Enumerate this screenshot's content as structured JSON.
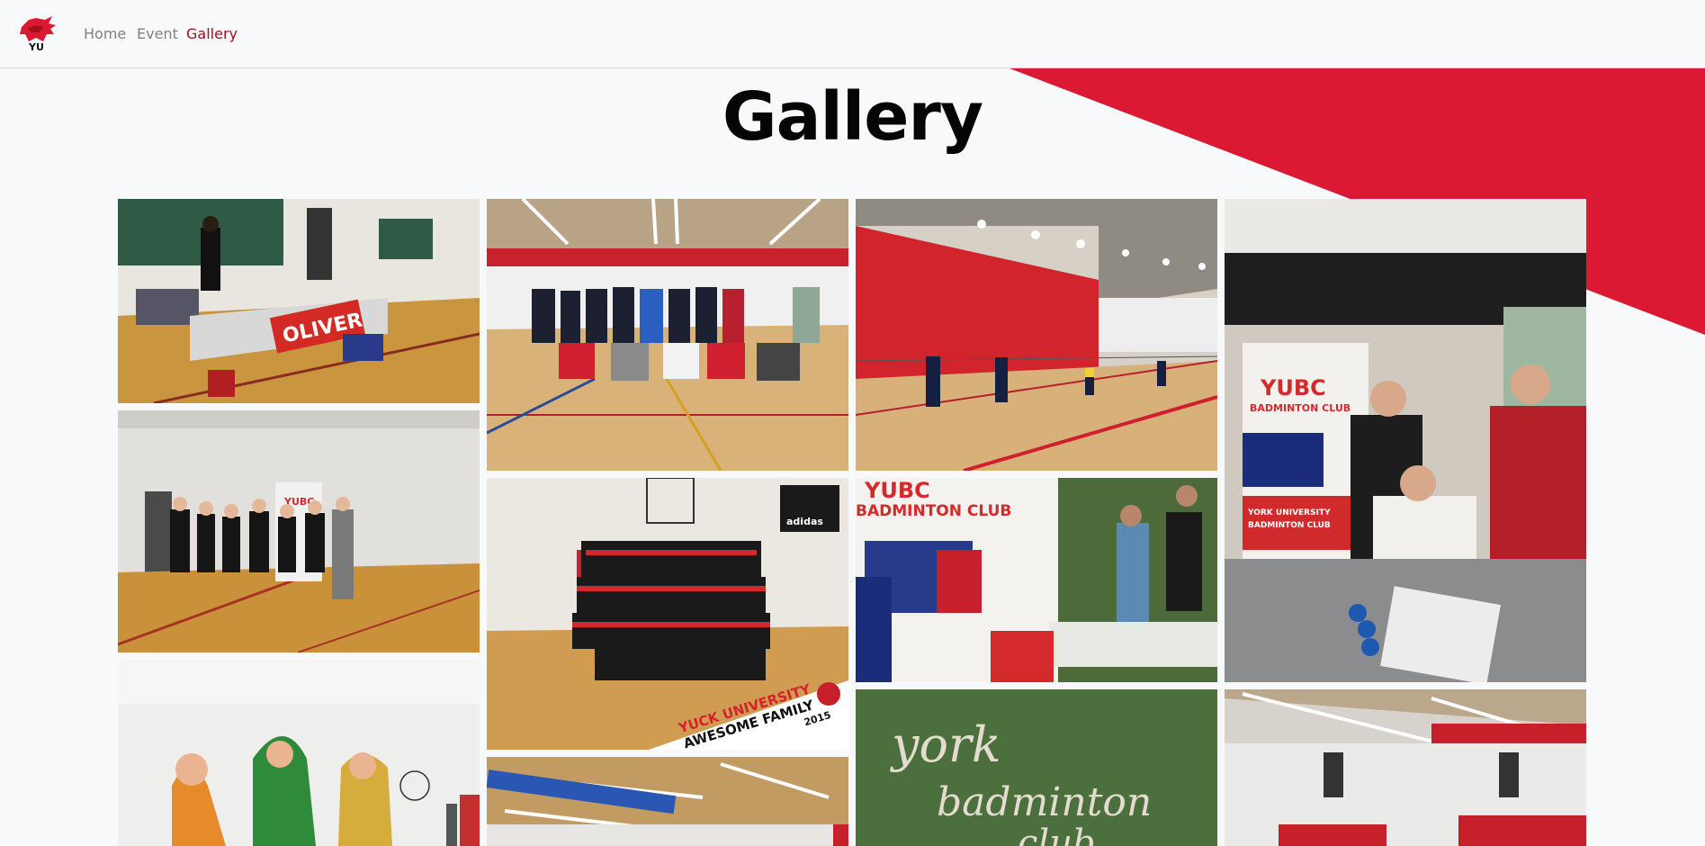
{
  "nav": {
    "logo_alt": "YU Badminton",
    "links": [
      {
        "label": "Home",
        "active": false
      },
      {
        "label": "Event",
        "active": false
      },
      {
        "label": "Gallery",
        "active": true
      }
    ]
  },
  "page": {
    "title": "Gallery"
  },
  "colors": {
    "brand_red": "#dc1932",
    "active_link": "#a0101b",
    "nav_link": "#808080",
    "background": "#f8f9fb"
  },
  "photos": {
    "p1": {
      "sign": "OLIVER"
    },
    "p5": {
      "banner_line1": "YUBC",
      "banner_line2": "BADMINTON CLUB"
    },
    "p6": {
      "label1": "YUCK UNIVERSITY",
      "label2": "AWESOME FAMILY",
      "label3": "2015",
      "scoreboard": "adidas"
    },
    "p7": {
      "banner_line1": "YUBC",
      "banner_line2": "BADMINTON CLUB"
    },
    "p8": {
      "banner_line1": "YUBC",
      "banner_line2": "BADMINTON CLUB",
      "sign_line1": "YORK UNIVERSITY",
      "sign_line2": "BADMINTON CLUB"
    },
    "p10": {
      "line1": "york",
      "line2": "badminton",
      "line3": "club"
    }
  }
}
